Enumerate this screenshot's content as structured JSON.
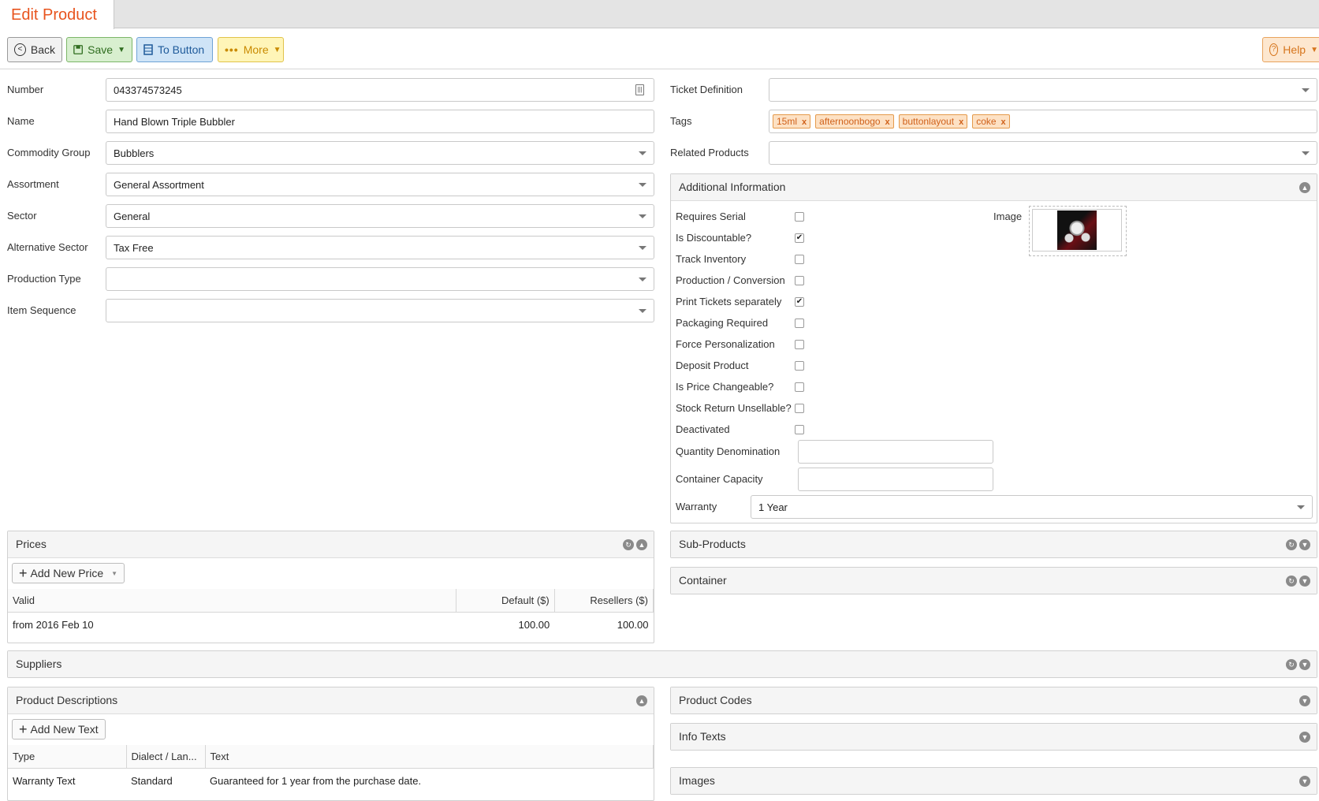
{
  "tab": {
    "title": "Edit Product"
  },
  "toolbar": {
    "back": "Back",
    "save": "Save",
    "to_button": "To Button",
    "more": "More",
    "help": "Help"
  },
  "left_fields": [
    {
      "label": "Number",
      "value": "043374573245",
      "type": "text-icon"
    },
    {
      "label": "Name",
      "value": "Hand Blown Triple Bubbler",
      "type": "text"
    },
    {
      "label": "Commodity Group",
      "value": "Bubblers",
      "type": "select"
    },
    {
      "label": "Assortment",
      "value": "General Assortment",
      "type": "select"
    },
    {
      "label": "Sector",
      "value": "General",
      "type": "select"
    },
    {
      "label": "Alternative Sector",
      "value": "Tax Free",
      "type": "select"
    },
    {
      "label": "Production Type",
      "value": "",
      "type": "select"
    },
    {
      "label": "Item Sequence",
      "value": "",
      "type": "select"
    }
  ],
  "right_fields": {
    "ticket_definition": {
      "label": "Ticket Definition",
      "value": ""
    },
    "tags": {
      "label": "Tags",
      "items": [
        "15ml",
        "afternoonbogo",
        "buttonlayout",
        "coke"
      ]
    },
    "related_products": {
      "label": "Related Products",
      "value": ""
    }
  },
  "additional_info": {
    "title": "Additional Information",
    "image_label": "Image",
    "checkboxes": [
      {
        "label": "Requires Serial",
        "checked": false
      },
      {
        "label": "Is Discountable?",
        "checked": true
      },
      {
        "label": "Track Inventory",
        "checked": false
      },
      {
        "label": "Production / Conversion",
        "checked": false
      },
      {
        "label": "Print Tickets separately",
        "checked": true
      },
      {
        "label": "Packaging Required",
        "checked": false
      },
      {
        "label": "Force Personalization",
        "checked": false
      },
      {
        "label": "Deposit Product",
        "checked": false
      },
      {
        "label": "Is Price Changeable?",
        "checked": false
      },
      {
        "label": "Stock Return Unsellable?",
        "checked": false
      },
      {
        "label": "Deactivated",
        "checked": false
      }
    ],
    "quantity_denomination": {
      "label": "Quantity Denomination",
      "value": ""
    },
    "container_capacity": {
      "label": "Container Capacity",
      "value": ""
    },
    "warranty": {
      "label": "Warranty",
      "value": "1 Year"
    }
  },
  "prices": {
    "title": "Prices",
    "add_button": "Add New Price",
    "columns": [
      "Valid",
      "Default ($)",
      "Resellers ($)"
    ],
    "rows": [
      [
        "from 2016 Feb 10",
        "100.00",
        "100.00"
      ]
    ]
  },
  "sub_products": {
    "title": "Sub-Products"
  },
  "container": {
    "title": "Container"
  },
  "suppliers": {
    "title": "Suppliers"
  },
  "descriptions": {
    "title": "Product Descriptions",
    "add_button": "Add New Text",
    "columns": [
      "Type",
      "Dialect / Lan...",
      "Text"
    ],
    "rows": [
      [
        "Warranty Text",
        "Standard",
        "Guaranteed for 1 year from the purchase date."
      ]
    ]
  },
  "product_codes": {
    "title": "Product Codes"
  },
  "info_texts": {
    "title": "Info Texts"
  },
  "images": {
    "title": "Images"
  },
  "colors": {
    "accent": "#e8541e",
    "save": "#d8efcf",
    "to_button": "#cfe4f7",
    "more": "#fff5b8",
    "help": "#fde7cf",
    "tag": "#fde1c4"
  }
}
